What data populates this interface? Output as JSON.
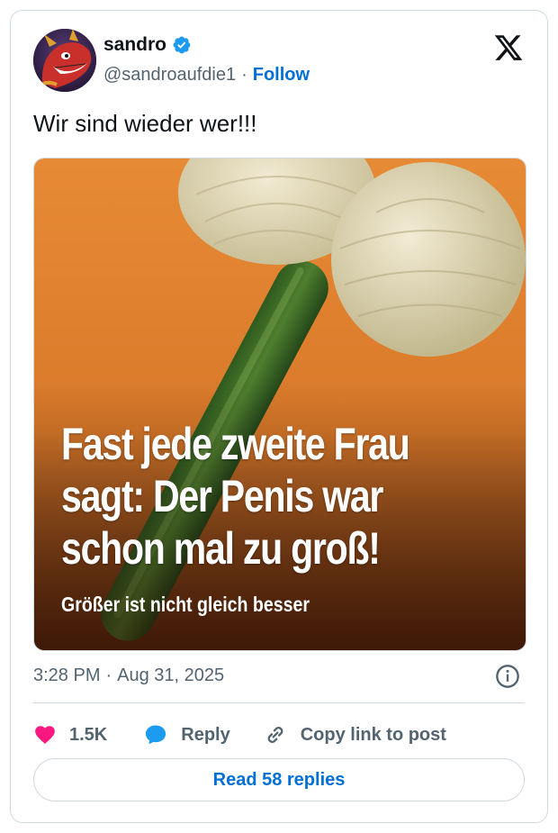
{
  "user": {
    "display_name": "sandro",
    "handle": "@sandroaufdie1",
    "follow_label": "Follow"
  },
  "tweet": {
    "text": "Wir sind wieder wer!!!",
    "image": {
      "headline": [
        "Fast jede zweite Frau",
        "sagt: Der Penis war",
        "schon mal zu groß!"
      ],
      "subline": "Größer ist nicht gleich besser"
    },
    "time": "3:28 PM",
    "date": "Aug 31, 2025"
  },
  "actions": {
    "like_count": "1.5K",
    "reply_label": "Reply",
    "copy_link_label": "Copy link to post",
    "read_replies_label": "Read 58 replies"
  },
  "icons": [
    "verified-badge-icon",
    "x-logo-icon",
    "info-icon",
    "heart-icon",
    "reply-bubble-icon",
    "link-icon"
  ],
  "colors": {
    "link_blue": "#006fd6",
    "verified_blue": "#1d9bf0",
    "heart_pink": "#f91880",
    "image_orange": "#e0802a"
  }
}
